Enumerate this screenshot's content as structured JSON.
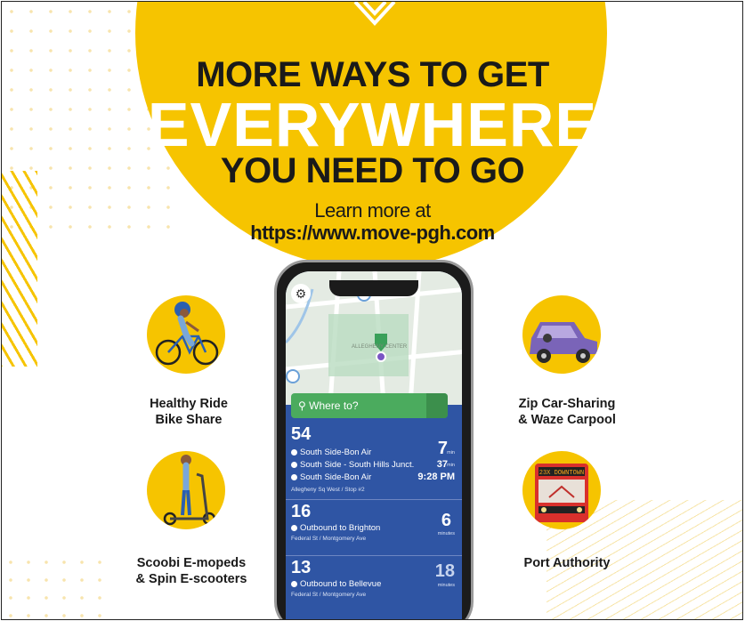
{
  "headline": {
    "line1": "MORE WAYS TO GET",
    "line2": "EVERYWHERE",
    "line3": "YOU NEED TO GO",
    "learn": "Learn more at",
    "url": "https://www.move-pgh.com"
  },
  "services": {
    "bike": {
      "line1": "Healthy Ride",
      "line2": "Bike Share",
      "icon": "cyclist-icon"
    },
    "scoot": {
      "line1": "Scoobi E-mopeds",
      "line2": "& Spin E-scooters",
      "icon": "scooter-icon"
    },
    "car": {
      "line1": "Zip Car-Sharing",
      "line2": "& Waze Carpool",
      "icon": "car-icon"
    },
    "bus": {
      "line1": "Port Authority",
      "icon": "bus-icon",
      "destination_sign": "23X DOWNTOWN"
    }
  },
  "phone": {
    "search_placeholder": "Where to?",
    "map_label": "ALLEGHENY CENTER",
    "routes": [
      {
        "number": "54",
        "lines": [
          "South Side-Bon Air",
          "South Side - South Hills Junct.",
          "South Side-Bon Air"
        ],
        "times": [
          "7",
          "37",
          "9:28 PM"
        ],
        "units": [
          "min",
          "min",
          ""
        ],
        "stop": "Allegheny Sq West / Stop #2"
      },
      {
        "number": "16",
        "lines": [
          "Outbound to Brighton"
        ],
        "times": [
          "6"
        ],
        "units": [
          "minutes"
        ],
        "stop": "Federal St / Montgomery Ave"
      },
      {
        "number": "13",
        "lines": [
          "Outbound to Bellevue"
        ],
        "times": [
          "18"
        ],
        "units": [
          "minutes"
        ],
        "stop": "Federal St / Montgomery Ave"
      }
    ]
  },
  "colors": {
    "accent": "#f6c400",
    "transit_blue": "#2f55a4",
    "search_green": "#4bab5e"
  }
}
